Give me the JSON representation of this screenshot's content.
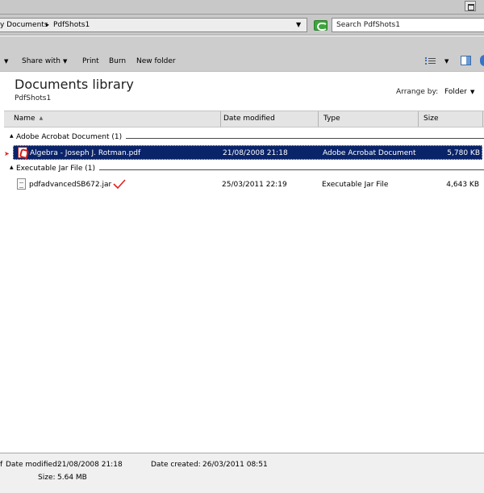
{
  "address": {
    "crumbs": [
      "y Documents",
      "PdfShots1"
    ],
    "search_placeholder": "Search PdfShots1"
  },
  "toolbar": {
    "share_with": "Share with",
    "print": "Print",
    "burn": "Burn",
    "new_folder": "New folder"
  },
  "library": {
    "title": "Documents library",
    "subtitle": "PdfShots1",
    "arrange_by_label": "Arrange by:",
    "arrange_by_value": "Folder"
  },
  "columns": {
    "name": "Name",
    "date_modified": "Date modified",
    "type": "Type",
    "size": "Size"
  },
  "groups": [
    {
      "label": "Adobe Acrobat Document (1)",
      "files": [
        {
          "name": "Algebra - Joseph J. Rotman.pdf",
          "date": "21/08/2008 21:18",
          "type": "Adobe Acrobat Document",
          "size": "5,780 KB",
          "icon": "pdf-file-icon",
          "selected": true
        }
      ]
    },
    {
      "label": "Executable Jar File (1)",
      "files": [
        {
          "name": "pdfadvancedSB672.jar",
          "date": "25/03/2011 22:19",
          "type": "Executable Jar File",
          "size": "4,643 KB",
          "icon": "jar-file-icon",
          "selected": false
        }
      ]
    }
  ],
  "details": {
    "date_modified_label": "Date modified:",
    "date_modified_value": "21/08/2008 21:18",
    "date_created_label": "Date created:",
    "date_created_value": "26/03/2011 08:51",
    "size_label": "Size:",
    "size_value": "5.64 MB",
    "leading_fragment": "f"
  },
  "colors": {
    "selection": "#0a246a",
    "annotation": "#e02020"
  }
}
